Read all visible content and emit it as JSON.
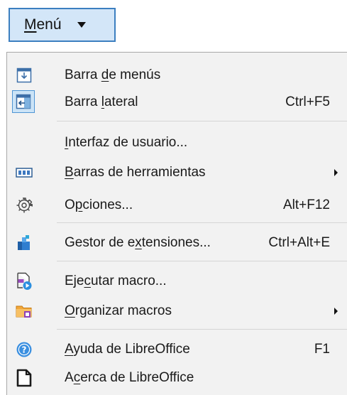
{
  "menu_button": {
    "label_first": "M",
    "label_rest": "enú"
  },
  "menu": {
    "items": [
      {
        "pre": "Barra ",
        "key": "d",
        "post": "e menús",
        "accel": "",
        "icon": "menubar-icon"
      },
      {
        "pre": "Barra ",
        "key": "l",
        "post": "ateral",
        "accel": "Ctrl+F5",
        "icon": "sidebar-icon"
      },
      {
        "pre": "",
        "key": "I",
        "post": "nterfaz de usuario...",
        "accel": "",
        "icon": ""
      },
      {
        "pre": "",
        "key": "B",
        "post": "arras de herramientas",
        "accel": "",
        "icon": "toolbars-icon"
      },
      {
        "pre": "O",
        "key": "p",
        "post": "ciones...",
        "accel": "Alt+F12",
        "icon": "gear-icon"
      },
      {
        "pre": "Gestor de e",
        "key": "x",
        "post": "tensiones...",
        "accel": "Ctrl+Alt+E",
        "icon": "extension-manager-icon"
      },
      {
        "pre": "Eje",
        "key": "c",
        "post": "utar macro...",
        "accel": "",
        "icon": "run-macro-icon"
      },
      {
        "pre": "",
        "key": "O",
        "post": "rganizar macros",
        "accel": "",
        "icon": "organize-macros-icon"
      },
      {
        "pre": "",
        "key": "A",
        "post": "yuda de LibreOffice",
        "accel": "F1",
        "icon": "help-icon"
      },
      {
        "pre": "A",
        "key": "c",
        "post": "erca de LibreOffice",
        "accel": "",
        "icon": "about-icon"
      }
    ]
  },
  "colors": {
    "button_bg": "#d3e6f8",
    "button_border": "#3c7fc0",
    "popup_bg": "#f2f2f2",
    "accent_blue": "#1e73c8"
  }
}
